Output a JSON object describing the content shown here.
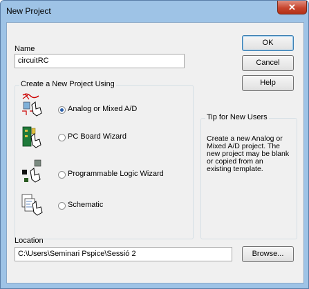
{
  "window": {
    "title": "New Project",
    "close_icon": "close-icon"
  },
  "name": {
    "label": "Name",
    "value": "circuitRC"
  },
  "buttons": {
    "ok": "OK",
    "cancel": "Cancel",
    "help": "Help",
    "browse": "Browse..."
  },
  "create_group": {
    "title": "Create a New Project Using",
    "selected": "Analog or Mixed A/D",
    "options": [
      {
        "label": "Analog or Mixed A/D",
        "icon": "analog-circuit-icon",
        "selected": true
      },
      {
        "label": "PC Board Wizard",
        "icon": "pc-board-icon",
        "selected": false
      },
      {
        "label": "Programmable Logic Wizard",
        "icon": "programmable-logic-icon",
        "selected": false
      },
      {
        "label": "Schematic",
        "icon": "schematic-icon",
        "selected": false
      }
    ]
  },
  "tip": {
    "title": "Tip for New Users",
    "text": "Create a new Analog or Mixed A/D project.  The new project may be blank or copied from an existing template."
  },
  "location": {
    "label": "Location",
    "value": "C:\\Users\\Seminari Pspice\\Sessió 2"
  },
  "colors": {
    "title_bar": "#9ec3e6",
    "close_button": "#c7452f",
    "dialog_bg": "#f0f0f0",
    "radio_dot": "#2a5ea8"
  }
}
